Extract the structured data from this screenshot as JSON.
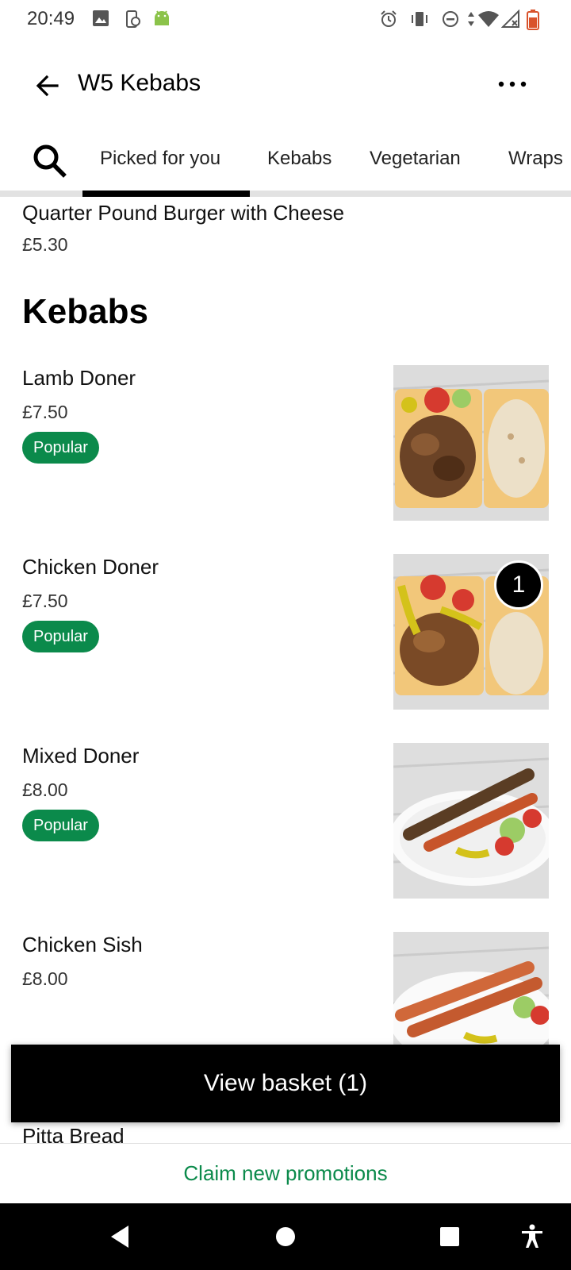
{
  "status_bar": {
    "time": "20:49",
    "icons": [
      "image-icon",
      "screen-rotation-icon",
      "android-icon",
      "alarm-icon",
      "vibrate-icon",
      "dnd-icon",
      "data-arrows-icon",
      "wifi-icon",
      "signal-icon",
      "battery-icon"
    ]
  },
  "header": {
    "back_icon": "arrow-left",
    "title": "W5 Kebabs",
    "more_icon": "more-horizontal"
  },
  "tabs": {
    "search_icon": "search",
    "items": [
      {
        "label": "Picked for you",
        "active": true
      },
      {
        "label": "Kebabs",
        "active": false
      },
      {
        "label": "Vegetarian",
        "active": false
      },
      {
        "label": "Wraps",
        "active": false
      }
    ]
  },
  "previous_item": {
    "name": "Quarter Pound Burger with Cheese",
    "price": "£5.30"
  },
  "section": {
    "title": "Kebabs",
    "items": [
      {
        "name": "Lamb Doner",
        "price": "£7.50",
        "badge": "Popular"
      },
      {
        "name": "Chicken Doner",
        "price": "£7.50",
        "badge": "Popular",
        "basket_qty": "1"
      },
      {
        "name": "Mixed Doner",
        "price": "£8.00",
        "badge": "Popular"
      },
      {
        "name": "Chicken Sish",
        "price": "£8.00"
      },
      {
        "name": "Pitta Bread"
      }
    ]
  },
  "basket": {
    "label": "View basket (1)"
  },
  "promo": {
    "label": "Claim new promotions"
  },
  "nav": {
    "icons": [
      "back-icon",
      "home-icon",
      "recents-icon",
      "accessibility-icon"
    ]
  },
  "colors": {
    "brand_green": "#0b8a4b",
    "black": "#000000",
    "tab_track": "#e2e2e2"
  }
}
